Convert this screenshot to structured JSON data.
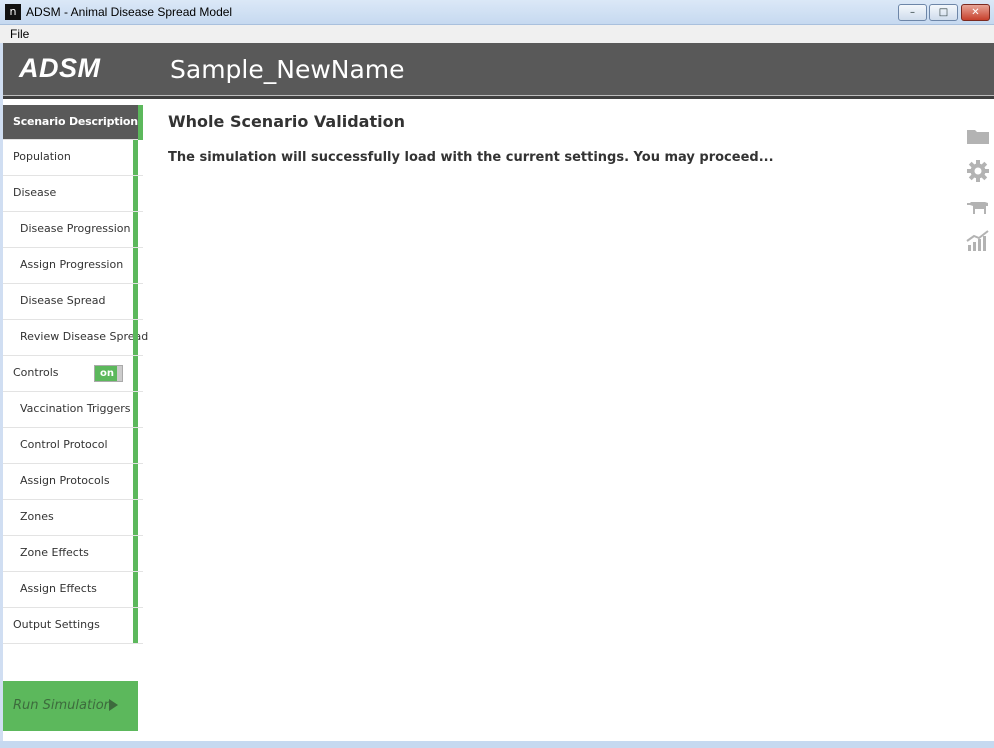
{
  "window": {
    "title": "ADSM - Animal Disease Spread Model",
    "app_icon_glyph": "n",
    "min_glyph": "–",
    "max_glyph": "□",
    "close_glyph": "✕"
  },
  "menu": {
    "file": "File"
  },
  "header": {
    "logo": "ADSM",
    "scenario_name": "Sample_NewName"
  },
  "sidebar": {
    "items": [
      {
        "label": "Scenario Description",
        "active": true
      },
      {
        "label": "Population"
      },
      {
        "label": "Disease"
      },
      {
        "label": "Disease Progression"
      },
      {
        "label": "Assign Progression"
      },
      {
        "label": "Disease Spread"
      },
      {
        "label": "Review Disease Spread"
      },
      {
        "label": "Controls",
        "toggle": "on"
      },
      {
        "label": "Vaccination Triggers"
      },
      {
        "label": "Control Protocol"
      },
      {
        "label": "Assign Protocols"
      },
      {
        "label": "Zones"
      },
      {
        "label": "Zone Effects"
      },
      {
        "label": "Assign Effects"
      },
      {
        "label": "Output Settings"
      }
    ],
    "run_simulation": "Run Simulation"
  },
  "main": {
    "title": "Whole Scenario Validation",
    "message": "The simulation will successfully load with the current settings. You may proceed..."
  },
  "right_icons": [
    "folder-icon",
    "gear-icon",
    "cow-icon",
    "chart-icon"
  ],
  "colors": {
    "accent_green": "#5cb85c",
    "header_gray": "#595959",
    "icon_gray": "#b3b3b3"
  }
}
